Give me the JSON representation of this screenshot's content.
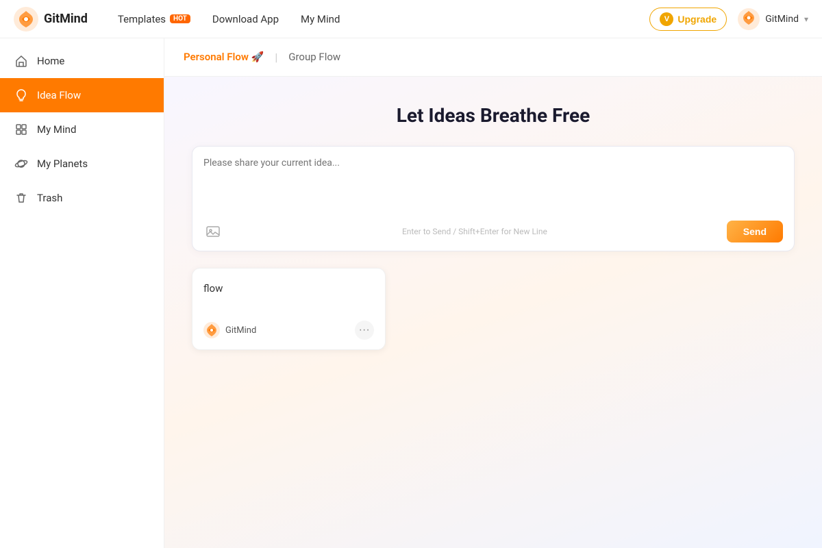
{
  "header": {
    "logo_text": "GitMind",
    "nav": [
      {
        "id": "templates",
        "label": "Templates",
        "badge": "Hot"
      },
      {
        "id": "download",
        "label": "Download App"
      },
      {
        "id": "mymind",
        "label": "My Mind"
      }
    ],
    "upgrade_label": "Upgrade",
    "upgrade_icon": "V",
    "user_label": "GitMind",
    "user_chevron": "▾"
  },
  "sidebar": {
    "items": [
      {
        "id": "home",
        "label": "Home",
        "icon": "home"
      },
      {
        "id": "idea-flow",
        "label": "Idea Flow",
        "icon": "lightbulb",
        "active": true
      },
      {
        "id": "my-mind",
        "label": "My Mind",
        "icon": "grid"
      },
      {
        "id": "my-planets",
        "label": "My Planets",
        "icon": "planet"
      },
      {
        "id": "trash",
        "label": "Trash",
        "icon": "trash"
      }
    ]
  },
  "tabs": [
    {
      "id": "personal",
      "label": "Personal Flow 🚀",
      "active": true
    },
    {
      "id": "group",
      "label": "Group Flow",
      "active": false
    }
  ],
  "main": {
    "title": "Let Ideas Breathe Free",
    "idea_placeholder": "Please share your current idea...",
    "hint_text": "Enter to Send / Shift+Enter for New Line",
    "send_label": "Send"
  },
  "cards": [
    {
      "id": "card-1",
      "title": "flow",
      "user": "GitMind",
      "more": "···"
    }
  ],
  "colors": {
    "accent": "#ff7a00",
    "accent_light": "#ffb347",
    "active_bg": "#ff7a00"
  }
}
